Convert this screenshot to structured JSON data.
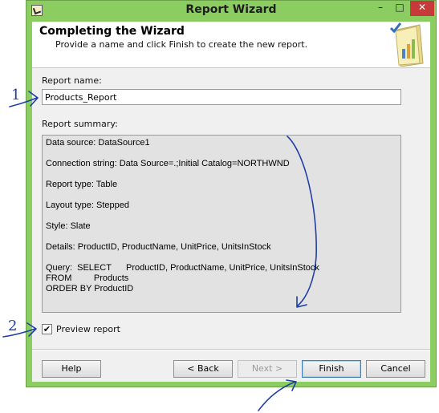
{
  "window": {
    "title": "Report Wizard",
    "controls": {
      "minimize": "–",
      "maximize": "□",
      "close": "✕"
    }
  },
  "header": {
    "title": "Completing the Wizard",
    "subtitle": "Provide a name and click Finish to create the new report."
  },
  "form": {
    "name_label": "Report name:",
    "name_value": "Products_Report",
    "summary_label": "Report summary:",
    "summary_lines": [
      "Data source: DataSource1",
      "Connection string: Data Source=.;Initial Catalog=NORTHWND",
      "Report type: Table",
      "Layout type: Stepped",
      "Style: Slate",
      "Details: ProductID, ProductName, UnitPrice, UnitsInStock"
    ],
    "query_lines": [
      "Query:  SELECT      ProductID, ProductName, UnitPrice, UnitsInStock",
      "FROM         Products",
      "ORDER BY ProductID"
    ],
    "preview_label": "Preview report",
    "preview_checked": true
  },
  "buttons": {
    "help": "Help",
    "back": "< Back",
    "next": "Next >",
    "finish": "Finish",
    "cancel": "Cancel"
  },
  "annotations": {
    "marker_1": "1",
    "marker_2": "2"
  }
}
